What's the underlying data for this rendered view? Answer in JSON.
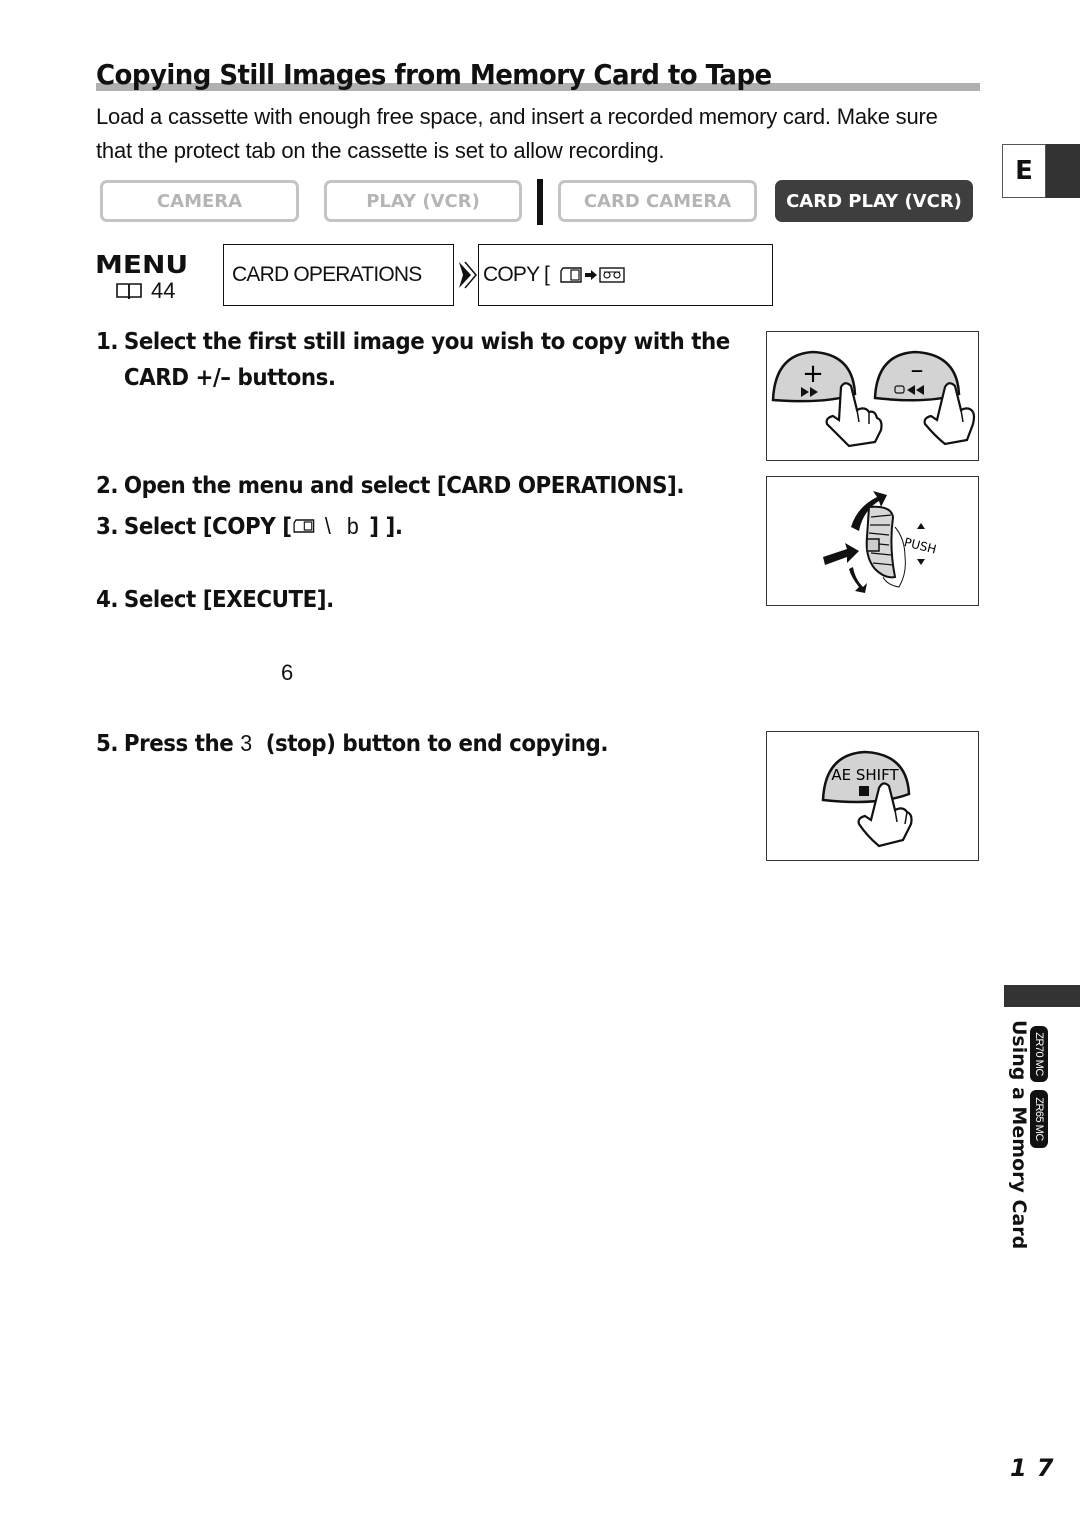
{
  "header": {
    "title": "Copying Still Images from Memory Card to Tape",
    "intro": "Load a cassette with enough free space, and insert a recorded memory card. Make sure that the protect tab on the cassette is set to allow recording."
  },
  "modes": {
    "items": [
      {
        "label": "CAMERA",
        "active": false
      },
      {
        "label": "PLAY (VCR)",
        "active": false
      },
      {
        "label": "CARD CAMERA",
        "active": false
      },
      {
        "label": "CARD PLAY (VCR)",
        "active": true
      }
    ]
  },
  "menu": {
    "label": "MENU",
    "page_ref_icon": "book-icon",
    "page_ref": "44",
    "path": [
      {
        "text": "CARD OPERATIONS"
      },
      {
        "text": "COPY [",
        "icons": [
          "memory-card-icon",
          "arrow-right-icon",
          "cassette-icon"
        ]
      }
    ]
  },
  "steps": [
    {
      "num": "1.",
      "line1": "Select the first still image you wish to copy with the",
      "line2": "CARD +/– buttons."
    },
    {
      "num": "2.",
      "text": "Open the menu and select [CARD OPERATIONS]."
    },
    {
      "num": "3.",
      "prefix": "Select [COPY [",
      "glyphs": " \\   b  ",
      "suffix": "] ]."
    },
    {
      "num": "4.",
      "text": "Select [EXECUTE]."
    },
    {
      "num": "5.",
      "prefix": "Press the ",
      "glyph": "3",
      "suffix": "  (stop) button to end copying."
    }
  ],
  "stray_glyph": "6",
  "illustrations": {
    "card_buttons": {
      "plus": "+",
      "minus": "–"
    },
    "dial": {
      "label": "PUSH"
    },
    "stop_button": {
      "label": "AE SHIFT"
    }
  },
  "side": {
    "language_tab": "E",
    "section_label": "Using a Memory Card",
    "models": [
      "ZR70 MC",
      "ZR65 MC"
    ]
  },
  "page_number": "17"
}
